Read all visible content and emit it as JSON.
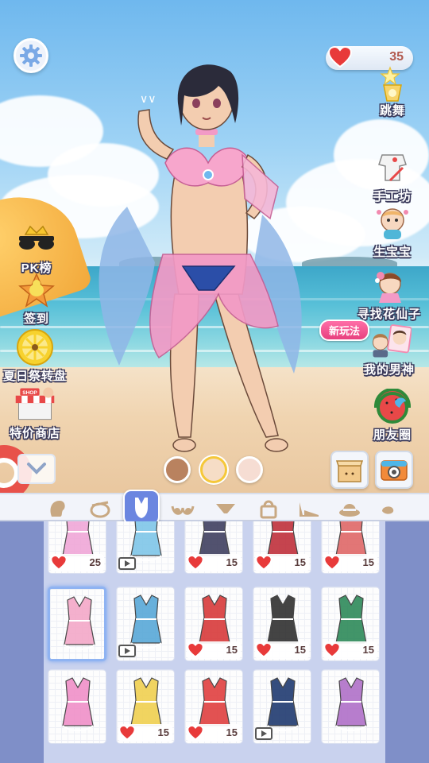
{
  "hud": {
    "hearts": "35"
  },
  "left_menu": [
    {
      "key": "pk",
      "label": "PK榜"
    },
    {
      "key": "checkin",
      "label": "签到"
    },
    {
      "key": "wheel",
      "label": "夏日祭转盘"
    },
    {
      "key": "shop",
      "label": "特价商店",
      "icon_text": "SHOP"
    }
  ],
  "right_menu": [
    {
      "key": "dance",
      "label": "跳舞"
    },
    {
      "key": "craft",
      "label": "手工坊"
    },
    {
      "key": "baby",
      "label": "生宝宝"
    },
    {
      "key": "fairy",
      "label": "寻找花仙子"
    },
    {
      "key": "godmale",
      "label": "我的男神"
    },
    {
      "key": "moments",
      "label": "朋友圈"
    }
  ],
  "new_badge": "新玩法",
  "skin_swatches": [
    "#b9825f",
    "#f6ddc6",
    "#f6ddd3"
  ],
  "categories": [
    "hair",
    "accessory",
    "swimsuit",
    "bra",
    "panties",
    "bag",
    "shoes",
    "hat",
    "misc"
  ],
  "grid": {
    "rows": [
      [
        {
          "cost": "25",
          "type": "heart",
          "color": "#f0a7d8"
        },
        {
          "cost": "",
          "type": "video",
          "color": "#7fc6e8"
        },
        {
          "cost": "15",
          "type": "heart",
          "color": "#404060"
        },
        {
          "cost": "15",
          "type": "heart",
          "color": "#c0303c"
        },
        {
          "cost": "15",
          "type": "heart",
          "color": "#e06868"
        }
      ],
      [
        {
          "cost": "",
          "type": "none",
          "color": "#f4a8c8",
          "selected": true
        },
        {
          "cost": "",
          "type": "video",
          "color": "#58a8d8"
        },
        {
          "cost": "15",
          "type": "heart",
          "color": "#d83a3a"
        },
        {
          "cost": "15",
          "type": "heart",
          "color": "#303030"
        },
        {
          "cost": "15",
          "type": "heart",
          "color": "#2e8a5a"
        }
      ],
      [
        {
          "cost": "",
          "type": "none",
          "color": "#f090c8"
        },
        {
          "cost": "15",
          "type": "heart",
          "color": "#f0d050"
        },
        {
          "cost": "15",
          "type": "heart",
          "color": "#e04040"
        },
        {
          "cost": "",
          "type": "video",
          "color": "#203a70"
        },
        {
          "cost": "",
          "type": "none",
          "color": "#b070c8"
        }
      ]
    ]
  }
}
